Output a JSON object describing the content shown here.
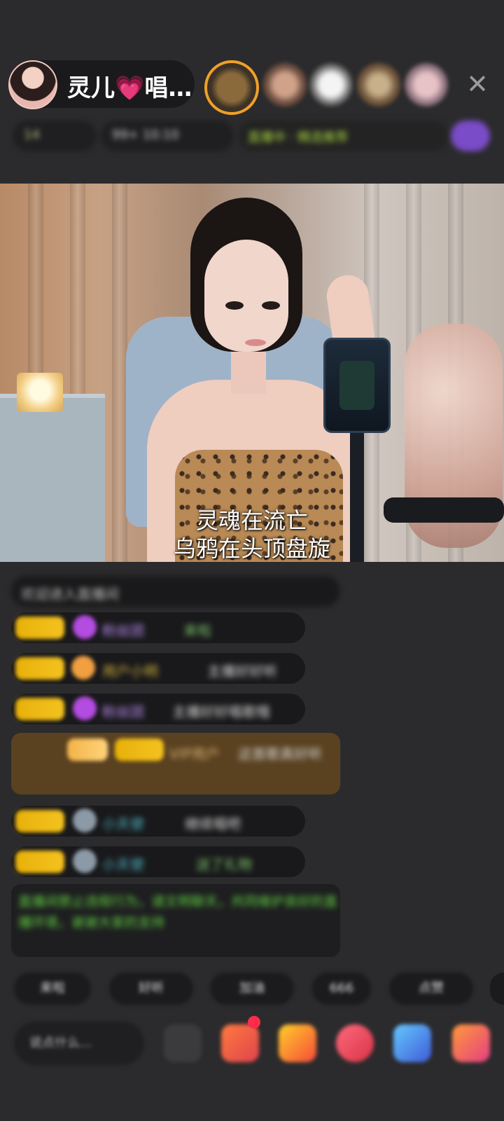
{
  "header": {
    "host_name": "灵儿💗唱…",
    "close_label": "✕",
    "info_chips": [
      "14",
      "99+ 10:10",
      "直播中 · 精选推荐",
      ""
    ]
  },
  "video": {
    "lyric_line1": "灵魂在流亡",
    "lyric_line2": "乌鸦在头顶盘旋"
  },
  "chat": {
    "notice": "欢迎进入直播间",
    "messages": [
      {
        "name": "粉丝团",
        "text": "来啦"
      },
      {
        "name": "用户小明",
        "text": "主播好好听"
      },
      {
        "name": "粉丝团",
        "text": "主播好好唱歌哦"
      },
      {
        "name": "VIP用户",
        "text": "这首歌真好听"
      },
      {
        "name": "小天使",
        "text": "继续唱吧"
      },
      {
        "name": "小天使",
        "text": "送了礼物"
      }
    ],
    "system": "直播间禁止违规行为，请文明聊天，共同维护良好的直播环境，谢谢大家的支持"
  },
  "quick_tags": [
    "来啦",
    "好听",
    "加油",
    "666",
    "点赞"
  ],
  "bottom": {
    "input_placeholder": "说点什么..."
  }
}
